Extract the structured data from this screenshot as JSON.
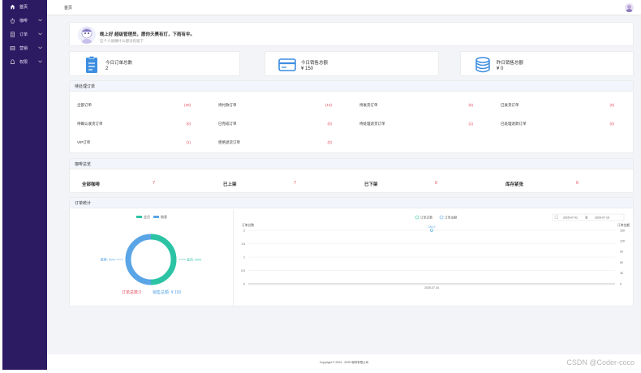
{
  "sidebar": {
    "items": [
      {
        "label": "首页",
        "icon": "home-icon",
        "active": true
      },
      {
        "label": "咖啡",
        "icon": "coffee-icon"
      },
      {
        "label": "订单",
        "icon": "order-icon"
      },
      {
        "label": "营销",
        "icon": "marketing-icon"
      },
      {
        "label": "权限",
        "icon": "permission-icon"
      }
    ]
  },
  "topbar": {
    "breadcrumb": "首页"
  },
  "welcome": {
    "greeting": "晚上好 超级管理员，愿你天黑有灯，下雨有伞。",
    "sub": "这个人很懒什么都没有留下"
  },
  "stats": [
    {
      "label": "今日订单总数",
      "value": "2",
      "icon": "clipboard-icon"
    },
    {
      "label": "今日销售总额",
      "value": "¥ 150",
      "icon": "credit-card-icon"
    },
    {
      "label": "昨日销售总额",
      "value": "¥ 0",
      "icon": "coins-icon"
    }
  ],
  "pending": {
    "title": "待处理订单",
    "items": [
      {
        "name": "全部订单",
        "count": "(20)"
      },
      {
        "name": "待付款订单",
        "count": "(13)"
      },
      {
        "name": "待发货订单",
        "count": "(5)"
      },
      {
        "name": "已发货订单",
        "count": "(0)"
      },
      {
        "name": "待确认收货订单",
        "count": "(0)"
      },
      {
        "name": "已完成订单",
        "count": "(0)"
      },
      {
        "name": "待处理退货订单",
        "count": "(1)"
      },
      {
        "name": "已处理退款订单",
        "count": "(0)"
      },
      {
        "name": "VIP订单",
        "count": "(1)"
      },
      {
        "name": "拒绝退货订单",
        "count": "(0)"
      }
    ]
  },
  "overview": {
    "title": "咖啡总览",
    "items": [
      {
        "name": "全部咖啡",
        "count": "7"
      },
      {
        "name": "已上架",
        "count": "7"
      },
      {
        "name": "已下架",
        "count": "0"
      },
      {
        "name": "库存紧张",
        "count": "6"
      }
    ]
  },
  "order_stats": {
    "title": "订单统计",
    "pie_footer_count": "订单总数:2",
    "pie_footer_amount": "销售总额: ¥ 150",
    "date_start": "2025-07-01",
    "date_sep": "至",
    "date_end": "2025-07-16"
  },
  "chart_data": [
    {
      "type": "pie",
      "series": [
        {
          "name": "会员",
          "value": 50,
          "color": "#2bc3a4"
        },
        {
          "name": "散客",
          "value": 50,
          "color": "#5aa5e6"
        }
      ],
      "slice_labels": [
        "会员: 50%",
        "散客: 50%"
      ],
      "legend": [
        "会员",
        "散客"
      ]
    },
    {
      "type": "line",
      "legend": [
        "订单总数",
        "订单金额"
      ],
      "y_left_label": "订单总数",
      "y_right_label": "订单金额",
      "y_left_ticks": [
        "2",
        "1.5",
        "1",
        "0.5",
        "0"
      ],
      "y_right_ticks": [
        "150",
        "120",
        "90",
        "60",
        "30",
        "0"
      ],
      "x": [
        "2025-07-16"
      ],
      "series": [
        {
          "name": "订单总数",
          "values": [
            2
          ],
          "color": "#2bc3a4"
        },
        {
          "name": "订单金额",
          "values": [
            150
          ],
          "color": "#5aa5e6"
        }
      ],
      "point_label": "150.0",
      "ylim_left": [
        0,
        2
      ],
      "ylim_right": [
        0,
        150
      ]
    }
  ],
  "footer": {
    "text": "Copyright © 2024 - 2025 咖啡有限公司"
  },
  "watermark": "CSDN @Coder-coco"
}
